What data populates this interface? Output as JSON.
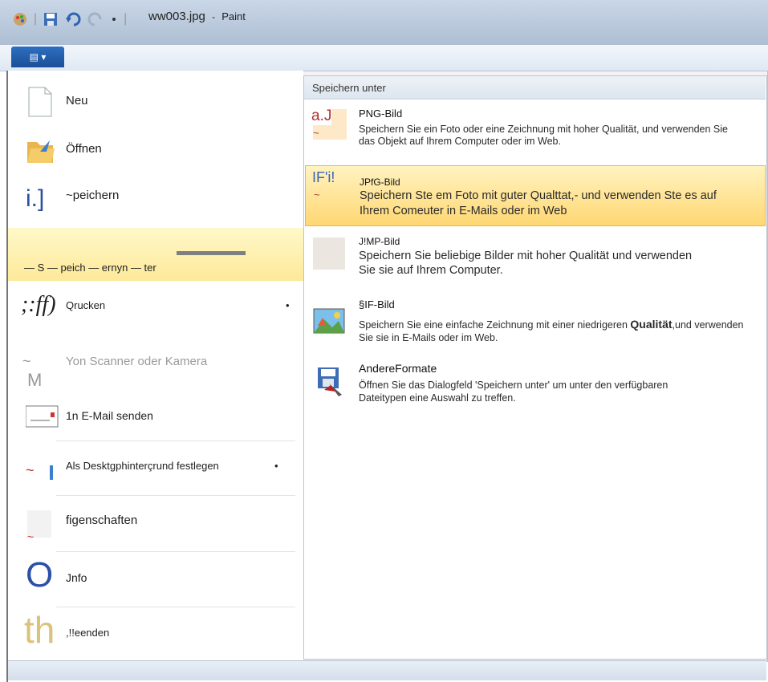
{
  "window": {
    "title": "ww003.jpg",
    "app_name": "Paint",
    "separator": "-"
  },
  "app_menu": {
    "label": "▤ ▾"
  },
  "left_menu": [
    {
      "label": "Neu",
      "icon": "new-document-icon"
    },
    {
      "label": "Öffnen",
      "icon": "open-folder-icon"
    },
    {
      "label": "~peichern",
      "icon": "save-icon"
    },
    {
      "label": "Speichern unter",
      "display": "— S — peich — ernyn — ter",
      "icon": "save-as-icon",
      "highlighted": true
    },
    {
      "label": "Qrucken",
      "icon": "print-icon",
      "arrow": "•"
    },
    {
      "label": "Yon Scanner oder Kamera",
      "icon": "scanner-icon"
    },
    {
      "label": "1n E-Mail senden",
      "icon": "email-icon"
    },
    {
      "label": "Als Desktgphinterçrund festlegen",
      "icon": "desktop-background-icon",
      "arrow": "•"
    },
    {
      "label": "figenschaften",
      "icon": "properties-icon"
    },
    {
      "label": "Jnfo",
      "icon": "info-icon"
    },
    {
      "label": ",!!eenden",
      "icon": "exit-icon"
    }
  ],
  "icon_text": {
    "print": ";:ff)",
    "scanner_a": "~",
    "scanner_b": "M",
    "email_dash": "~",
    "info": "O",
    "exit": "th"
  },
  "save_as_panel": {
    "header": "Speichern unter",
    "options": [
      {
        "icon_text": "a.J",
        "icon_sub": "~",
        "title": "PNG-Bild",
        "description": "Speichern Sie ein Foto oder eine Zeichnung mit hoher Qualität, und verwenden Sie das Objekt auf Ihrem Computer oder im Web."
      },
      {
        "icon_text": "IF'i!",
        "icon_sub": "~",
        "title": "JPfG-Bild",
        "description": "Speichern Ste em Foto mit guter Qualttat,- und verwenden Ste es auf Ihrem Comeuter in E-Mails oder im Web",
        "highlighted": true
      },
      {
        "icon_text": "",
        "icon_sub": "",
        "title": "J!MP-Bild",
        "description": "Speichern Sie beliebige Bilder mit hoher Qualität und verwenden Sie sie auf Ihrem Computer."
      },
      {
        "icon_text": "",
        "icon_sub": "",
        "title": "§IF-Bild",
        "description_a": "Speichern Sie eine einfache Zeichnung mit einer niedrigeren",
        "description_bold": "Qualität",
        "description_b": ",und verwenden Sie sie in E-Mails oder im Web."
      },
      {
        "icon_text": "",
        "icon_sub": "",
        "title": "AndereFormate",
        "description": "Öffnen Sie das Dialogfeld 'Speichern unter' um unter den verfügbaren Dateitypen eine Auswahl zu treffen."
      }
    ]
  },
  "colors": {
    "highlight_top": "#fff3c0",
    "highlight_bottom": "#ffd773",
    "accent_blue": "#1a4f98",
    "title_bar": "#b9c9dc"
  }
}
